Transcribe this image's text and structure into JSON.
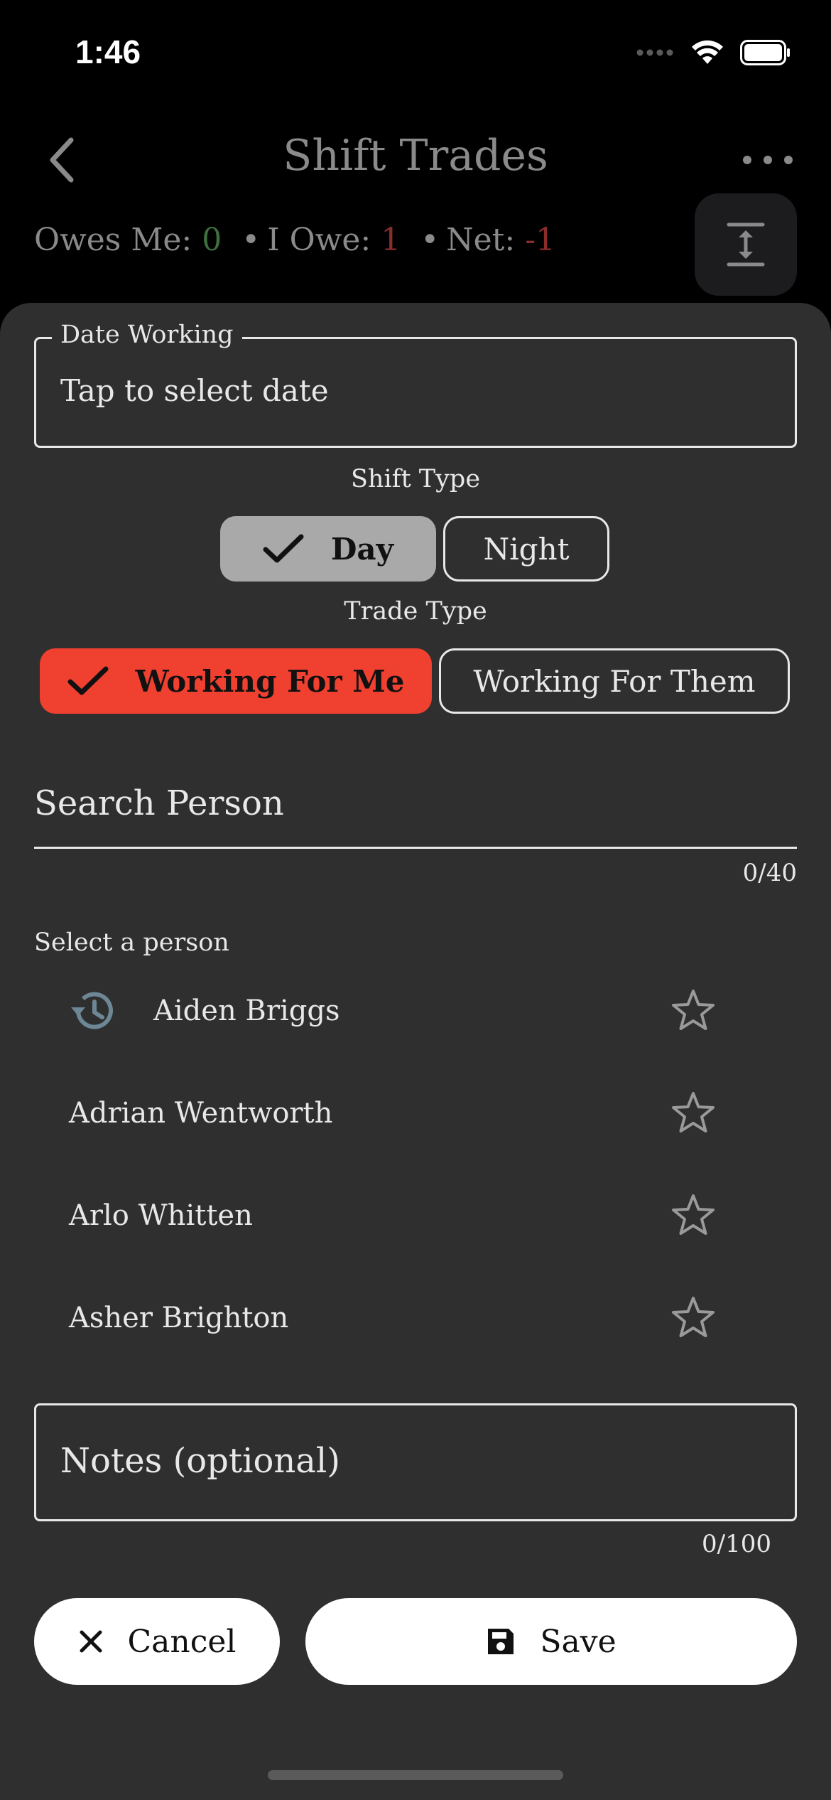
{
  "status_bar": {
    "time": "1:46"
  },
  "nav": {
    "title": "Shift Trades"
  },
  "summary": {
    "owes_me_label": "Owes Me:",
    "owes_me_value": "0",
    "i_owe_label": "I Owe:",
    "i_owe_value": "1",
    "net_label": "Net:",
    "net_value": "-1",
    "separator": "•"
  },
  "form": {
    "date_label": "Date Working",
    "date_value": "Tap to select date",
    "shift_type_label": "Shift Type",
    "shift_options": [
      "Day",
      "Night"
    ],
    "shift_selected": "Day",
    "trade_type_label": "Trade Type",
    "trade_options": [
      "Working For Me",
      "Working For Them"
    ],
    "trade_selected": "Working For Me",
    "search_placeholder": "Search Person",
    "search_counter": "0/40",
    "select_person_label": "Select a person",
    "people": [
      {
        "name": "Aiden Briggs",
        "recent": true
      },
      {
        "name": "Adrian Wentworth",
        "recent": false
      },
      {
        "name": "Arlo Whitten",
        "recent": false
      },
      {
        "name": "Asher Brighton",
        "recent": false
      }
    ],
    "notes_placeholder": "Notes (optional)",
    "notes_counter": "0/100"
  },
  "actions": {
    "cancel_label": "Cancel",
    "save_label": "Save"
  },
  "icons": {
    "back": "chevron-left-icon",
    "more": "more-horizontal-icon",
    "expand": "expand-vertical-icon",
    "check": "check-icon",
    "history": "history-icon",
    "star": "star-outline-icon",
    "close": "close-icon",
    "save": "floppy-disk-icon"
  },
  "colors": {
    "background": "#000000",
    "sheet": "#2f2f2f",
    "accent_red": "#f04030",
    "positive_green": "#3f6e3f",
    "negative_red": "#8a2c2c",
    "selected_gray": "#a9a9a9"
  }
}
